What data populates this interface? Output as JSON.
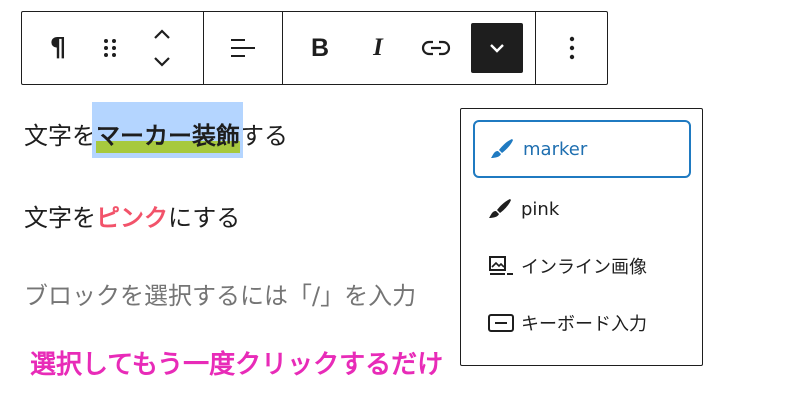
{
  "toolbar": {
    "paragraph_icon": "¶",
    "bold_label": "B",
    "italic_label": "I"
  },
  "content": {
    "line1": {
      "before": "文字を",
      "marked": "マーカー装飾",
      "after": "する"
    },
    "line2": {
      "before": "文字を",
      "pink": "ピンク",
      "after": "にする"
    },
    "placeholder": "ブロックを選択するには「/」を入力",
    "annotation": "選択してもう一度クリックするだけ"
  },
  "dropdown": {
    "items": [
      {
        "label": "marker",
        "icon": "brush-icon",
        "active": true
      },
      {
        "label": "pink",
        "icon": "brush-icon",
        "active": false
      },
      {
        "label": "インライン画像",
        "icon": "inline-image-icon",
        "active": false
      },
      {
        "label": "キーボード入力",
        "icon": "keyboard-input-icon",
        "active": false
      }
    ]
  },
  "colors": {
    "accent": "#1f7ac1",
    "marker_highlight": "#a7c93e",
    "selection": "#b4d5ff",
    "pink_text": "#f2536a",
    "annotation": "#e82bb8"
  }
}
